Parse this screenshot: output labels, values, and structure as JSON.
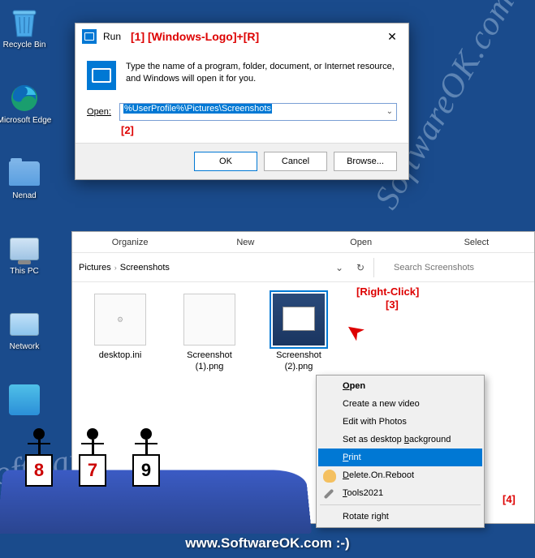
{
  "desktop": {
    "icons": [
      {
        "label": "Recycle Bin"
      },
      {
        "label": "Microsoft Edge"
      },
      {
        "label": "Nenad"
      },
      {
        "label": "This PC"
      },
      {
        "label": "Network"
      },
      {
        "label": ""
      }
    ]
  },
  "run_dialog": {
    "title": "Run",
    "annotation1": "[1]  [Windows-Logo]+[R]",
    "close": "✕",
    "description": "Type the name of a program, folder, document, or Internet resource, and Windows will open it for you.",
    "open_label": "Open:",
    "input_value": "%UserProfile%\\Pictures\\Screenshots",
    "annotation2": "[2]",
    "buttons": {
      "ok": "OK",
      "cancel": "Cancel",
      "browse": "Browse..."
    }
  },
  "explorer": {
    "menu": [
      "Organize",
      "New",
      "Open",
      "Select"
    ],
    "breadcrumb": [
      "Pictures",
      "Screenshots"
    ],
    "search_placeholder": "Search Screenshots",
    "files": [
      {
        "name": "desktop.ini"
      },
      {
        "name": "Screenshot (1).png"
      },
      {
        "name": "Screenshot (2).png"
      }
    ],
    "annotation3_line1": "[Right-Click]",
    "annotation3_line2": "[3]"
  },
  "context_menu": {
    "items": [
      {
        "label": "Open",
        "bold": true,
        "u": "O"
      },
      {
        "label": "Create a new video"
      },
      {
        "label": "Edit with Photos"
      },
      {
        "label": "Set as desktop background",
        "u": "b"
      },
      {
        "label": "Print",
        "hover": true,
        "u": "P"
      },
      {
        "label": "Delete.On.Reboot",
        "icon": "hand",
        "u": "D"
      },
      {
        "label": "Tools2021",
        "icon": "wrench",
        "u": "T"
      },
      {
        "label": "Rotate right"
      }
    ],
    "annotation4": "[4]"
  },
  "judges": {
    "scores": [
      "8",
      "7",
      "9"
    ]
  },
  "footer": "www.SoftwareOK.com :-)",
  "watermark": "SoftwareOK.com"
}
